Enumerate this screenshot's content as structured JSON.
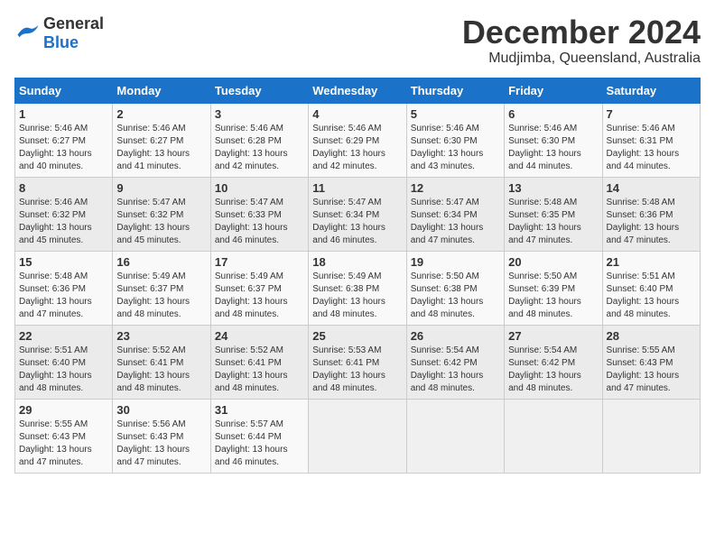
{
  "logo": {
    "general": "General",
    "blue": "Blue"
  },
  "title": {
    "month": "December 2024",
    "location": "Mudjimba, Queensland, Australia"
  },
  "weekdays": [
    "Sunday",
    "Monday",
    "Tuesday",
    "Wednesday",
    "Thursday",
    "Friday",
    "Saturday"
  ],
  "weeks": [
    [
      {
        "day": 1,
        "rise": "5:46 AM",
        "set": "6:27 PM",
        "hours": "13 hours and 40 minutes."
      },
      {
        "day": 2,
        "rise": "5:46 AM",
        "set": "6:27 PM",
        "hours": "13 hours and 41 minutes."
      },
      {
        "day": 3,
        "rise": "5:46 AM",
        "set": "6:28 PM",
        "hours": "13 hours and 42 minutes."
      },
      {
        "day": 4,
        "rise": "5:46 AM",
        "set": "6:29 PM",
        "hours": "13 hours and 42 minutes."
      },
      {
        "day": 5,
        "rise": "5:46 AM",
        "set": "6:30 PM",
        "hours": "13 hours and 43 minutes."
      },
      {
        "day": 6,
        "rise": "5:46 AM",
        "set": "6:30 PM",
        "hours": "13 hours and 44 minutes."
      },
      {
        "day": 7,
        "rise": "5:46 AM",
        "set": "6:31 PM",
        "hours": "13 hours and 44 minutes."
      }
    ],
    [
      {
        "day": 8,
        "rise": "5:46 AM",
        "set": "6:32 PM",
        "hours": "13 hours and 45 minutes."
      },
      {
        "day": 9,
        "rise": "5:47 AM",
        "set": "6:32 PM",
        "hours": "13 hours and 45 minutes."
      },
      {
        "day": 10,
        "rise": "5:47 AM",
        "set": "6:33 PM",
        "hours": "13 hours and 46 minutes."
      },
      {
        "day": 11,
        "rise": "5:47 AM",
        "set": "6:34 PM",
        "hours": "13 hours and 46 minutes."
      },
      {
        "day": 12,
        "rise": "5:47 AM",
        "set": "6:34 PM",
        "hours": "13 hours and 47 minutes."
      },
      {
        "day": 13,
        "rise": "5:48 AM",
        "set": "6:35 PM",
        "hours": "13 hours and 47 minutes."
      },
      {
        "day": 14,
        "rise": "5:48 AM",
        "set": "6:36 PM",
        "hours": "13 hours and 47 minutes."
      }
    ],
    [
      {
        "day": 15,
        "rise": "5:48 AM",
        "set": "6:36 PM",
        "hours": "13 hours and 47 minutes."
      },
      {
        "day": 16,
        "rise": "5:49 AM",
        "set": "6:37 PM",
        "hours": "13 hours and 48 minutes."
      },
      {
        "day": 17,
        "rise": "5:49 AM",
        "set": "6:37 PM",
        "hours": "13 hours and 48 minutes."
      },
      {
        "day": 18,
        "rise": "5:49 AM",
        "set": "6:38 PM",
        "hours": "13 hours and 48 minutes."
      },
      {
        "day": 19,
        "rise": "5:50 AM",
        "set": "6:38 PM",
        "hours": "13 hours and 48 minutes."
      },
      {
        "day": 20,
        "rise": "5:50 AM",
        "set": "6:39 PM",
        "hours": "13 hours and 48 minutes."
      },
      {
        "day": 21,
        "rise": "5:51 AM",
        "set": "6:40 PM",
        "hours": "13 hours and 48 minutes."
      }
    ],
    [
      {
        "day": 22,
        "rise": "5:51 AM",
        "set": "6:40 PM",
        "hours": "13 hours and 48 minutes."
      },
      {
        "day": 23,
        "rise": "5:52 AM",
        "set": "6:41 PM",
        "hours": "13 hours and 48 minutes."
      },
      {
        "day": 24,
        "rise": "5:52 AM",
        "set": "6:41 PM",
        "hours": "13 hours and 48 minutes."
      },
      {
        "day": 25,
        "rise": "5:53 AM",
        "set": "6:41 PM",
        "hours": "13 hours and 48 minutes."
      },
      {
        "day": 26,
        "rise": "5:54 AM",
        "set": "6:42 PM",
        "hours": "13 hours and 48 minutes."
      },
      {
        "day": 27,
        "rise": "5:54 AM",
        "set": "6:42 PM",
        "hours": "13 hours and 48 minutes."
      },
      {
        "day": 28,
        "rise": "5:55 AM",
        "set": "6:43 PM",
        "hours": "13 hours and 47 minutes."
      }
    ],
    [
      {
        "day": 29,
        "rise": "5:55 AM",
        "set": "6:43 PM",
        "hours": "13 hours and 47 minutes."
      },
      {
        "day": 30,
        "rise": "5:56 AM",
        "set": "6:43 PM",
        "hours": "13 hours and 47 minutes."
      },
      {
        "day": 31,
        "rise": "5:57 AM",
        "set": "6:44 PM",
        "hours": "13 hours and 46 minutes."
      },
      null,
      null,
      null,
      null
    ]
  ],
  "labels": {
    "sunrise": "Sunrise:",
    "sunset": "Sunset:",
    "daylight": "Daylight:"
  }
}
